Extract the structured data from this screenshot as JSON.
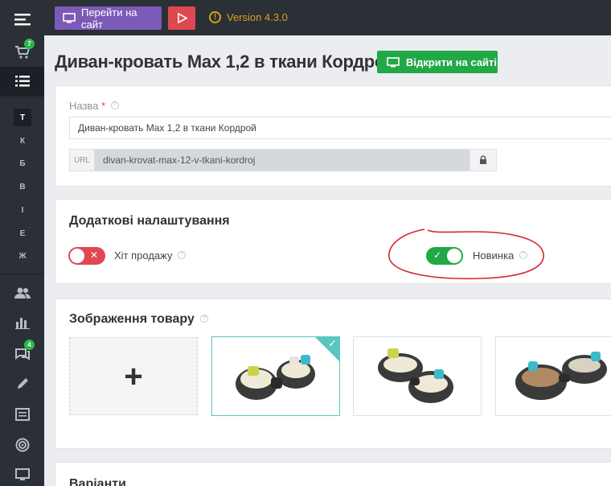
{
  "sidebar": {
    "cart_badge": "7",
    "letters": [
      "Т",
      "К",
      "Б",
      "В",
      "І",
      "Е",
      "Ж"
    ],
    "chat_badge": "4"
  },
  "topbar": {
    "site_button": "Перейти на сайт",
    "version": "Version 4.3.0"
  },
  "header": {
    "title": "Диван-кровать Max 1,2 в ткани Кордрой",
    "open_button": "Відкрити на сайті"
  },
  "name_field": {
    "label": "Назва",
    "required_mark": "*",
    "value": "Диван-кровать Max 1,2 в ткани Кордрой"
  },
  "url_field": {
    "tag": "URL",
    "value": "divan-krovat-max-12-v-tkani-kordroj"
  },
  "extra": {
    "title": "Додаткові налаштування",
    "hit_label": "Хіт продажу",
    "hit_on": false,
    "new_label": "Новинка",
    "new_on": true
  },
  "images": {
    "title": "Зображення товару",
    "add_symbol": "+"
  },
  "variants": {
    "title": "Варіанти"
  },
  "colors": {
    "accent_green": "#23a847",
    "accent_red": "#e04751",
    "purple": "#7c5ab8",
    "warning": "#d7a21b",
    "teal": "#59c7c0"
  }
}
